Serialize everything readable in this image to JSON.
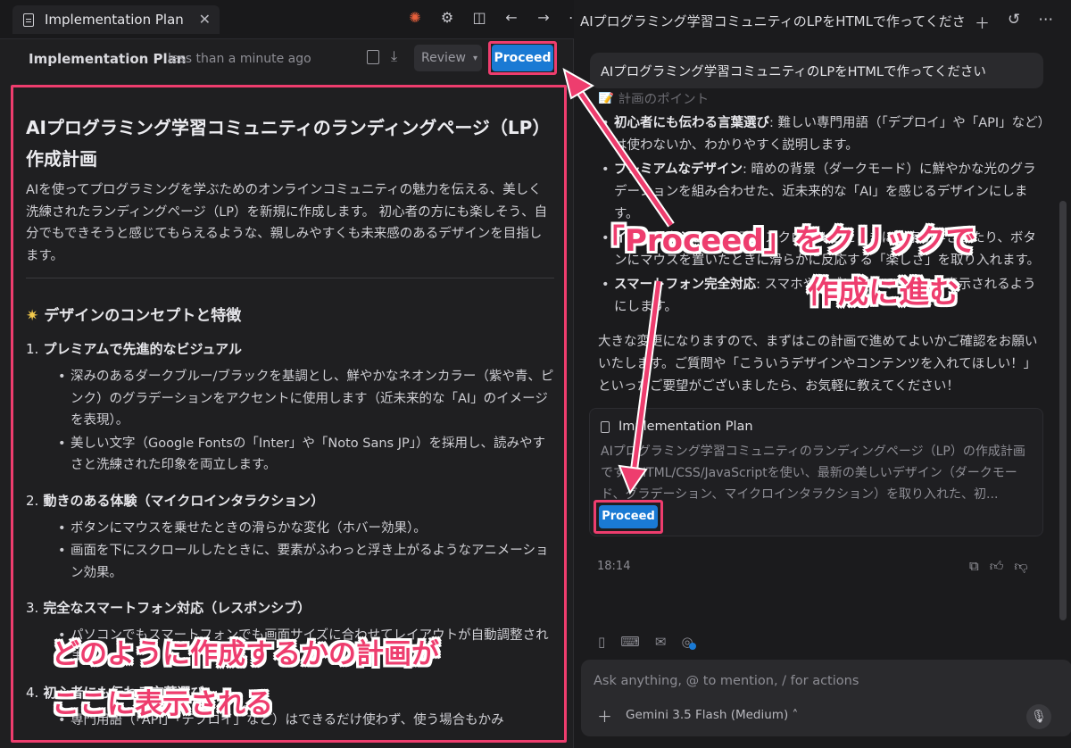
{
  "left": {
    "tab_label": "Implementation Plan",
    "header_title": "Implementation Plan",
    "header_time": "less than a minute ago",
    "review_label": "Review",
    "proceed_label": "Proceed",
    "doc": {
      "title": "AIプログラミング学習コミュニティのランディングページ（LP）作成計画",
      "intro": "AIを使ってプログラミングを学ぶためのオンラインコミュニティの魅力を伝える、美しく洗練されたランディングページ（LP）を新規に作成します。 初心者の方にも楽しそう、自分でもできそうと感じてもらえるような、親しみやすくも未来感のあるデザインを目指します。",
      "section_heading": "デザインのコンセプトと特徴",
      "sections": [
        {
          "num": "1.",
          "title": "プレミアムで先進的なビジュアル",
          "items": [
            "深みのあるダークブルー/ブラックを基調とし、鮮やかなネオンカラー（紫や青、ピンク）のグラデーションをアクセントに使用します（近未来的な「AI」のイメージを表現）。",
            "美しい文字（Google Fontsの「Inter」や「Noto Sans JP」）を採用し、読みやすさと洗練された印象を両立します。"
          ]
        },
        {
          "num": "2.",
          "title": "動きのある体験（マイクロインタラクション）",
          "items": [
            "ボタンにマウスを乗せたときの滑らかな変化（ホバー効果）。",
            "画面を下にスクロールしたときに、要素がふわっと浮き上がるようなアニメーション効果。"
          ]
        },
        {
          "num": "3.",
          "title": "完全なスマートフォン対応（レスポンシブ）",
          "items": [
            "パソコンでもスマートフォンでも画面サイズに合わせてレイアウトが自動調整されます。"
          ]
        },
        {
          "num": "4.",
          "title": "初心者にも伝わる言葉選び",
          "items": [
            "専門用語（「API」「デプロイ」など）はできるだけ使わず、使う場合もかみ"
          ]
        }
      ]
    }
  },
  "right": {
    "title": "AIプログラミング学習コミュニティのLPをHTMLで作ってください",
    "user_message": "AIプログラミング学習コミュニティのLPをHTMLで作ってください",
    "hint": "📝 計画のポイント",
    "bullets": [
      {
        "bold": "初心者にも伝わる言葉選び",
        "text": ": 難しい専門用語（「デプロイ」や「API」など）は使わないか、わかりやすく説明します。"
      },
      {
        "bold": "プレミアムなデザイン",
        "text": ": 暗めの背景（ダークモード）に鮮やかな光のグラデーションを組み合わせた、近未来的な「AI」を感じるデザインにします。"
      },
      {
        "bold": "インタラクション",
        "text": ": 画面をスクロールしたときに文字が浮き出たり、ボタンにマウスを置いたときに滑らかに反応する「楽しさ」を取り入れます。"
      },
      {
        "bold": "スマートフォン完全対応",
        "text": ": スマホやタブレットでも美しく表示されるようにします。"
      }
    ],
    "paragraph": "大きな変更になりますので、まずはこの計画で進めてよいかご確認をお願いいたします。ご質問や「こういうデザインやコンテンツを入れてほしい！」といったご要望がございましたら、お気軽に教えてください！",
    "card_title": "Implementation Plan",
    "card_desc": "AIプログラミング学習コミュニティのランディングページ（LP）の作成計画です。HTML/CSS/JavaScriptを使い、最新の美しいデザイン（ダークモード、グラデーション、マイクロインタラクション）を取り入れた、初...",
    "card_proceed": "Proceed",
    "time": "18:14",
    "composer_placeholder": "Ask anything, @ to mention, / for actions",
    "model": "Gemini 3.5 Flash (Medium)"
  },
  "callouts": {
    "c1": "「Proceed」をクリックで",
    "c2": "作成に進む",
    "c3": "どのように作成するかの計画が",
    "c4": "ここに表示される"
  },
  "colors": {
    "accent": "#ee3d6e",
    "button": "#1a7ad4",
    "background": "#1b1b1d"
  }
}
